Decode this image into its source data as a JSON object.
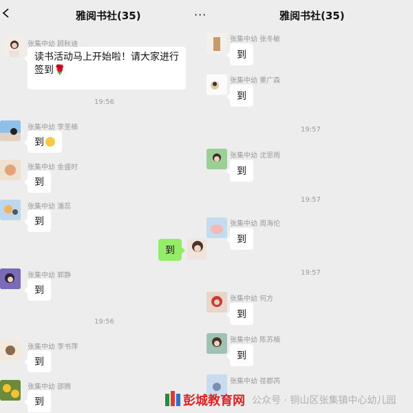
{
  "left_panel": {
    "title": "雅阅书社(35)",
    "messages": [
      {
        "sender": "张集中幼 顾秋迪",
        "text_line1": "读书活动马上开始啦！请大家进行",
        "text_line2": "签到"
      },
      {
        "time": "19:56"
      },
      {
        "sender": "张集中幼 李圣楠",
        "text": "到"
      },
      {
        "sender": "张集中幼 金盛时",
        "text": "到"
      },
      {
        "sender": "张集中幼 潘蕊",
        "text": "到"
      },
      {
        "self_text": "到"
      },
      {
        "sender": "张集中幼 郭静",
        "text": "到"
      },
      {
        "time": "19:56"
      },
      {
        "sender": "张集中幼 李书萍",
        "text": "到"
      },
      {
        "sender": "张集中幼 邵腾",
        "text": "到"
      }
    ]
  },
  "right_panel": {
    "title": "雅阅书社(35)",
    "menu_icon": "more-dots-icon",
    "messages": [
      {
        "sender": "张集中幼 张冬敏",
        "text": "到"
      },
      {
        "sender": "张集中幼 董广森",
        "text": "到"
      },
      {
        "time": "19:57"
      },
      {
        "sender": "张集中幼 沈思雨",
        "text": "到"
      },
      {
        "time": "19:57"
      },
      {
        "sender": "张集中幼 周海伦",
        "text": "到"
      },
      {
        "time": "19:57"
      },
      {
        "sender": "张集中幼 何方",
        "text": "到"
      },
      {
        "sender": "张集中幼 陈苏楠",
        "text": "到"
      },
      {
        "sender": "张集中幼 荏郡芮",
        "text": ""
      }
    ]
  },
  "watermark": {
    "logo_text": "彭城教育网",
    "text": "公众号 · 铜山区张集镇中心幼儿园"
  },
  "colors": {
    "self_bubble": "#95ec69",
    "bg": "#ededed"
  }
}
